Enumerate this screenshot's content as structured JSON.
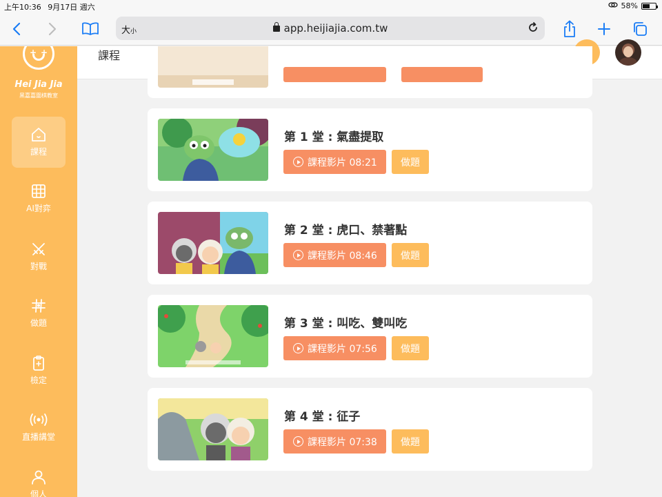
{
  "status_bar": {
    "time": "上午10:36",
    "date": "9月17日 週六",
    "battery": "58%",
    "battery_level": 0.58
  },
  "browser": {
    "text_size": "大",
    "text_size_small": "小",
    "url": "app.heijiajia.com.tw"
  },
  "sidebar": {
    "brand": "Hei Jia Jia",
    "brand_sub": "黑嘉嘉圍棋教室",
    "items": [
      {
        "label": "課程",
        "icon": "home-icon"
      },
      {
        "label": "AI對弈",
        "icon": "grid-icon"
      },
      {
        "label": "對戰",
        "icon": "crossed-swords-icon"
      },
      {
        "label": "做題",
        "icon": "hash-icon"
      },
      {
        "label": "檢定",
        "icon": "clipboard-icon"
      },
      {
        "label": "直播講堂",
        "icon": "broadcast-icon"
      },
      {
        "label": "個人",
        "icon": "person-icon"
      }
    ]
  },
  "header": {
    "title": "課程"
  },
  "lessons": [
    {
      "title": "第 1 堂 : 氣盡提取",
      "video_label": "課程影片 08:21",
      "quiz_label": "做題"
    },
    {
      "title": "第 2 堂 : 虎口、禁著點",
      "video_label": "課程影片 08:46",
      "quiz_label": "做題"
    },
    {
      "title": "第 3 堂 : 叫吃、雙叫吃",
      "video_label": "課程影片 07:56",
      "quiz_label": "做題"
    },
    {
      "title": "第 4 堂 : 征子",
      "video_label": "課程影片 07:38",
      "quiz_label": "做題"
    }
  ],
  "colors": {
    "sidebar": "#fdbc5c",
    "video_button": "#f78f63",
    "quiz_button": "#fdbc5c",
    "background": "#f2f2f2"
  }
}
